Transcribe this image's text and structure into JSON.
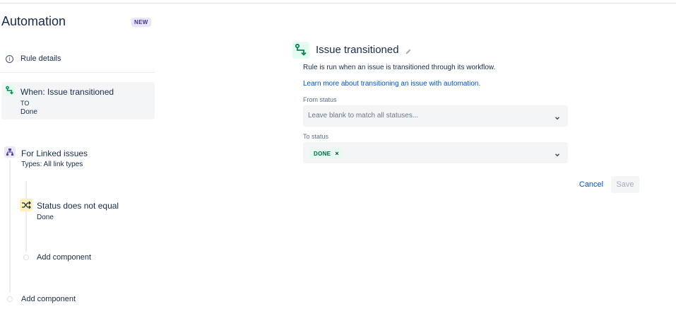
{
  "header": {
    "title": "Automation",
    "badge": "NEW"
  },
  "sidebar": {
    "rule_details": "Rule details",
    "trigger": {
      "title": "When: Issue transitioned",
      "to_label": "TO",
      "to_value": "Done",
      "icon": "transition-icon"
    },
    "branch": {
      "title": "For Linked issues",
      "subtitle": "Types: All link types",
      "icon": "branch-icon"
    },
    "condition": {
      "title": "Status does not equal",
      "subtitle": "Done",
      "icon": "shuffle-icon"
    },
    "add_component_inner": "Add component",
    "add_component_outer": "Add component"
  },
  "detail": {
    "title": "Issue transitioned",
    "description": "Rule is run when an issue is transitioned through its workflow.",
    "learn_link": "Learn more about transitioning an issue with automation.",
    "from_status": {
      "label": "From status",
      "placeholder": "Leave blank to match all statuses..."
    },
    "to_status": {
      "label": "To status",
      "selected": [
        "DONE"
      ]
    },
    "cancel": "Cancel",
    "save": "Save"
  },
  "colors": {
    "link": "#0052cc",
    "text": "#172b4d",
    "trigger_bg": "#e3fcef",
    "branch_bg": "#eae6ff",
    "condition_bg": "#fff0b3"
  }
}
